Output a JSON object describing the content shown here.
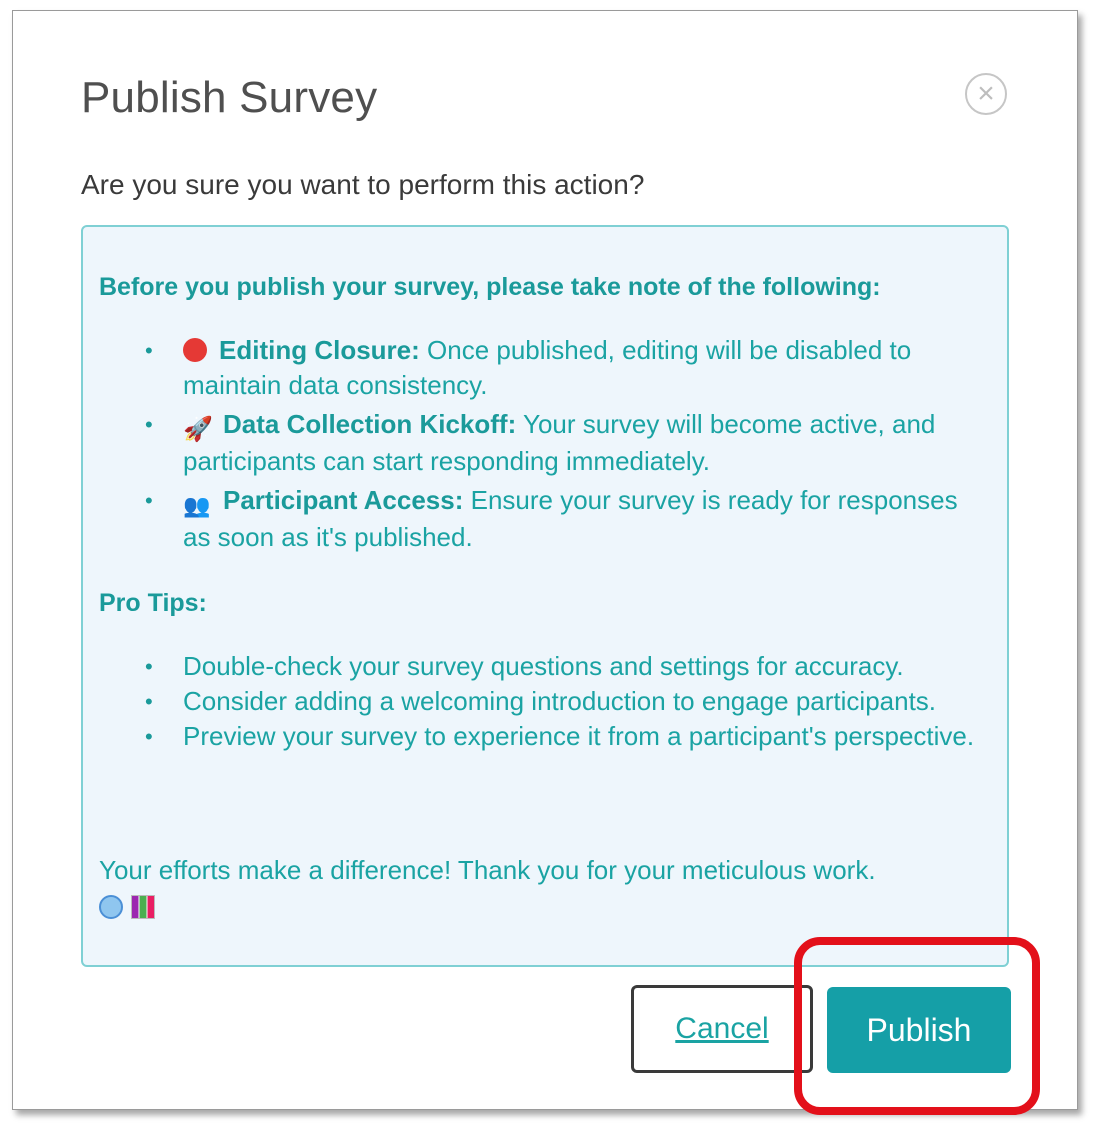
{
  "dialog": {
    "title": "Publish Survey",
    "close_icon": "close-circle-icon",
    "close_glyph": "×",
    "question": "Are you sure you want to perform this action?"
  },
  "info": {
    "intro": "Before you publish your survey, please take note of the following:",
    "notes": [
      {
        "icon": "red-circle-icon",
        "title": "Editing Closure:",
        "text": " Once published, editing will be disabled to maintain data consistency."
      },
      {
        "icon": "rocket-icon",
        "glyph": "🚀",
        "title": "Data Collection Kickoff:",
        "text": " Your survey will become active, and participants can start responding immediately."
      },
      {
        "icon": "people-icon",
        "glyph": "👥",
        "title": "Participant Access:",
        "text": " Ensure your survey is ready for responses as soon as it's published."
      }
    ],
    "tips_heading": "Pro Tips:",
    "tips": [
      "Double-check your survey questions and settings for accuracy.",
      "Consider adding a welcoming introduction to engage participants.",
      "Preview your survey to experience it from a participant's perspective."
    ],
    "closing": "Your efforts make a difference! Thank you for your meticulous work.",
    "closing_icons": [
      "smile-icon",
      "bar-chart-icon"
    ]
  },
  "buttons": {
    "cancel": "Cancel",
    "publish": "Publish"
  },
  "bullet": "•",
  "colors": {
    "accent": "#159fa7",
    "info_text": "#1aa3a3",
    "info_bg": "#eef6fc",
    "highlight": "#e3101a"
  }
}
